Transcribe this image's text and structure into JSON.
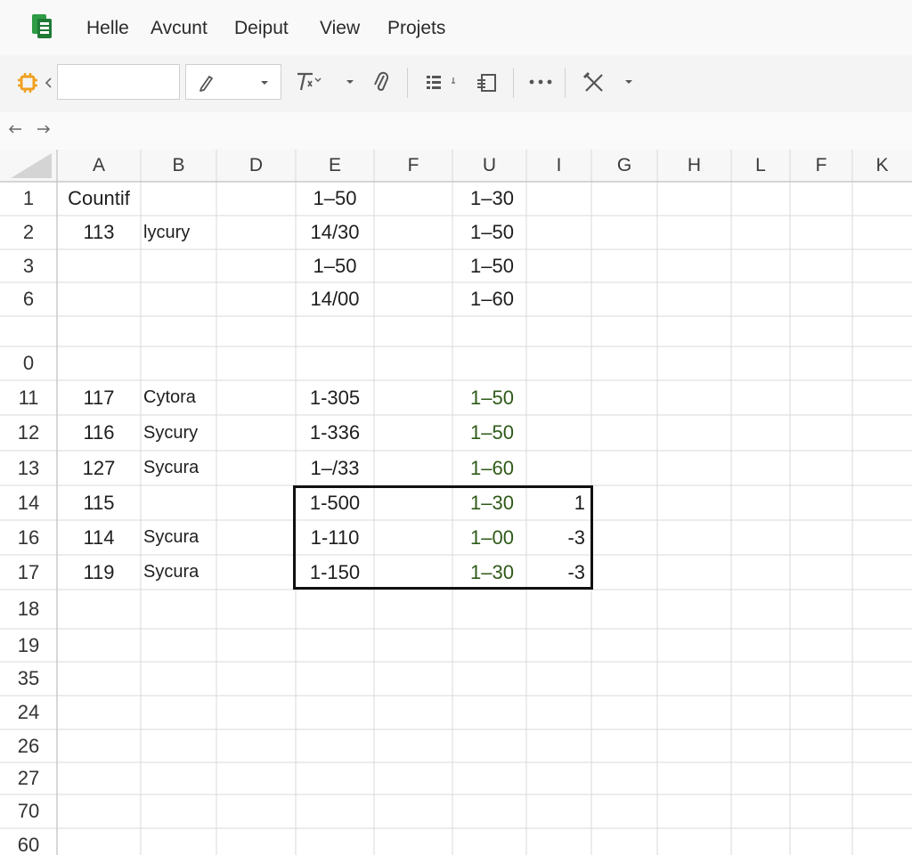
{
  "menubar": {
    "logo_icon": "spreadsheet-logo-icon",
    "items": [
      "Helle",
      "Avcunt",
      "Deiput",
      "View",
      "Projets"
    ]
  },
  "toolbar": {
    "icons": [
      "chip-icon",
      "chevron-left-icon",
      "pen-icon",
      "chevron-down-icon",
      "text-format-icon",
      "chevron-down-icon",
      "attach-icon",
      "list-icon",
      "copy-icon",
      "more-icon",
      "tools-icon",
      "chevron-down-icon"
    ],
    "accent": "#f0a020"
  },
  "nav": {
    "back_icon": "arrow-left-icon",
    "forward_icon": "arrow-right-icon"
  },
  "grid": {
    "columns": [
      "A",
      "B",
      "D",
      "E",
      "F",
      "U",
      "I",
      "G",
      "H",
      "L",
      "F",
      "K"
    ],
    "row_labels": [
      "1",
      "2",
      "3",
      "6",
      "",
      "0",
      "11",
      "12",
      "13",
      "14",
      "16",
      "17",
      "18",
      "19",
      "35",
      "24",
      "26",
      "27",
      "70",
      "60"
    ],
    "rows": [
      {
        "A": "Countif",
        "B": "",
        "E": "1–50",
        "U": "1–30",
        "I": ""
      },
      {
        "A": "113",
        "B": "lycury",
        "E": "14/30",
        "U": "1–50",
        "I": ""
      },
      {
        "A": "",
        "B": "",
        "E": "1–50",
        "U": "1–50",
        "I": ""
      },
      {
        "A": "",
        "B": "",
        "E": "14/00",
        "U": "1–60",
        "I": ""
      },
      {
        "A": "",
        "B": "",
        "E": "",
        "U": "",
        "I": ""
      },
      {
        "A": "",
        "B": "",
        "E": "",
        "U": "",
        "I": ""
      },
      {
        "A": "117",
        "B": "Cytora",
        "E": "1-305",
        "U": "1–50",
        "I": ""
      },
      {
        "A": "116",
        "B": "Sycury",
        "E": "1-336",
        "U": "1–50",
        "I": ""
      },
      {
        "A": "127",
        "B": "Sycura",
        "E": "1–/33",
        "U": "1–60",
        "I": ""
      },
      {
        "A": "115",
        "B": "",
        "E": "1-500",
        "U": "1–30",
        "I": "1"
      },
      {
        "A": "114",
        "B": "Sycura",
        "E": "1-110",
        "U": "1–00",
        "I": "-3"
      },
      {
        "A": "119",
        "B": "Sycura",
        "E": "1-150",
        "U": "1–30",
        "I": "-3"
      }
    ],
    "green_text": "#2e5a18",
    "gridline": "#d9d9d9"
  }
}
